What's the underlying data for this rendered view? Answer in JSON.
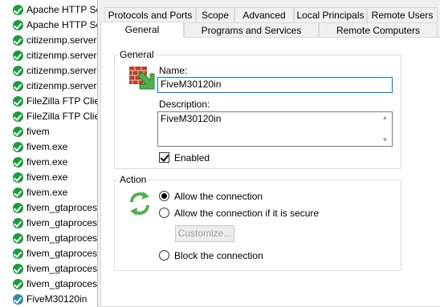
{
  "rules": {
    "items": [
      {
        "label": "Apache HTTP Se"
      },
      {
        "label": "Apache HTTP Se"
      },
      {
        "label": "citizenmp.server"
      },
      {
        "label": "citizenmp.server"
      },
      {
        "label": "citizenmp.server"
      },
      {
        "label": "citizenmp.server"
      },
      {
        "label": "FileZilla FTP Clie"
      },
      {
        "label": "FileZilla FTP Clie"
      },
      {
        "label": "fivem"
      },
      {
        "label": "fivem.exe"
      },
      {
        "label": "fivem.exe"
      },
      {
        "label": "fivem.exe"
      },
      {
        "label": "fivem.exe"
      },
      {
        "label": "fivem_gtaproces"
      },
      {
        "label": "fivem_gtaproces"
      },
      {
        "label": "fivem_gtaproces"
      },
      {
        "label": "fivem_gtaproces"
      },
      {
        "label": "fivem_gtaproces"
      },
      {
        "label": "fivem_gtaproces"
      },
      {
        "label": "FiveM30120in"
      }
    ]
  },
  "tabs": {
    "row1": [
      "Protocols and Ports",
      "Scope",
      "Advanced",
      "Local Principals",
      "Remote Users"
    ],
    "row2": [
      "General",
      "Programs and Services",
      "Remote Computers"
    ]
  },
  "general": {
    "legend": "General",
    "name_label": "Name:",
    "name_value": "FiveM30120in",
    "description_label": "Description:",
    "description_value": "FiveM30120in",
    "enabled_label": "Enabled"
  },
  "action": {
    "legend": "Action",
    "allow": "Allow the connection",
    "allow_secure": "Allow the connection if it is secure",
    "customize": "Customize...",
    "block": "Block the connection"
  }
}
